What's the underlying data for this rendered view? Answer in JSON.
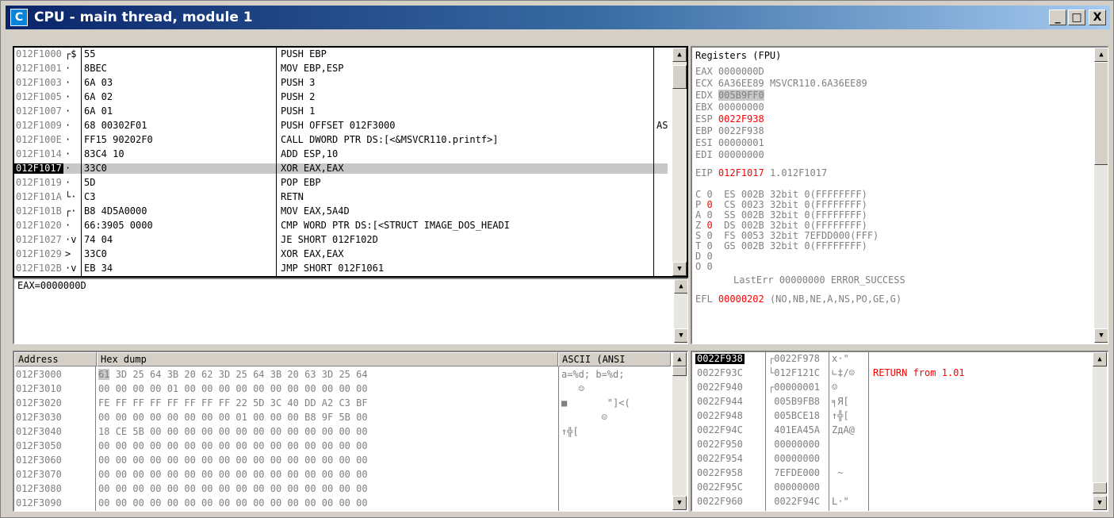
{
  "window": {
    "title": "CPU - main thread, module 1",
    "icon_letter": "C",
    "buttons": {
      "minimize": "_",
      "maximize": "□",
      "close": "X"
    }
  },
  "disasm": {
    "rows": [
      {
        "addr": "012F1000",
        "mark": "┌$",
        "hex": "55",
        "asm": "PUSH EBP",
        "cmt": ""
      },
      {
        "addr": "012F1001",
        "mark": "·",
        "hex": "8BEC",
        "asm": "MOV EBP,ESP",
        "cmt": ""
      },
      {
        "addr": "012F1003",
        "mark": "·",
        "hex": "6A 03",
        "asm": "PUSH 3",
        "cmt": ""
      },
      {
        "addr": "012F1005",
        "mark": "·",
        "hex": "6A 02",
        "asm": "PUSH 2",
        "cmt": ""
      },
      {
        "addr": "012F1007",
        "mark": "·",
        "hex": "6A 01",
        "asm": "PUSH 1",
        "cmt": ""
      },
      {
        "addr": "012F1009",
        "mark": "·",
        "hex": "68 00302F01",
        "asm": "PUSH OFFSET 012F3000",
        "cmt": "ASC"
      },
      {
        "addr": "012F100E",
        "mark": "·",
        "hex": "FF15 90202F0",
        "asm": "CALL DWORD PTR DS:[<&MSVCR110.printf>]",
        "cmt": ""
      },
      {
        "addr": "012F1014",
        "mark": "·",
        "hex": "83C4 10",
        "asm": "ADD ESP,10",
        "cmt": ""
      },
      {
        "addr": "012F1017",
        "mark": "·",
        "hex": "33C0",
        "asm": "XOR EAX,EAX",
        "cmt": ""
      },
      {
        "addr": "012F1019",
        "mark": "·",
        "hex": "5D",
        "asm": "POP EBP",
        "cmt": ""
      },
      {
        "addr": "012F101A",
        "mark": "└·",
        "hex": "C3",
        "asm": "RETN",
        "cmt": ""
      },
      {
        "addr": "012F101B",
        "mark": "┌·",
        "hex": "B8 4D5A0000",
        "asm": "MOV EAX,5A4D",
        "cmt": ""
      },
      {
        "addr": "012F1020",
        "mark": "·",
        "hex": "66:3905 0000",
        "asm": "CMP WORD PTR DS:[<STRUCT IMAGE_DOS_HEADI",
        "cmt": ""
      },
      {
        "addr": "012F1027",
        "mark": "·v",
        "hex": "74 04",
        "asm": "JE SHORT 012F102D",
        "cmt": ""
      },
      {
        "addr": "012F1029",
        "mark": ">",
        "hex": "33C0",
        "asm": "XOR EAX,EAX",
        "cmt": ""
      },
      {
        "addr": "012F102B",
        "mark": "·v",
        "hex": "EB 34",
        "asm": "JMP SHORT 012F1061",
        "cmt": ""
      }
    ]
  },
  "info": {
    "text": "EAX=0000000D"
  },
  "registers": {
    "header": "Registers (FPU)",
    "gp": [
      {
        "name": "EAX",
        "value": "0000000D",
        "note": ""
      },
      {
        "name": "ECX",
        "value": "6A36EE89",
        "note": "MSVCR110.6A36EE89"
      },
      {
        "name": "EDX",
        "value": "005B9FF0",
        "note": ""
      },
      {
        "name": "EBX",
        "value": "00000000",
        "note": ""
      },
      {
        "name": "ESP",
        "value": "0022F938",
        "note": ""
      },
      {
        "name": "EBP",
        "value": "0022F938",
        "note": ""
      },
      {
        "name": "ESI",
        "value": "00000001",
        "note": ""
      },
      {
        "name": "EDI",
        "value": "00000000",
        "note": ""
      }
    ],
    "eip": {
      "name": "EIP",
      "value": "012F1017",
      "note": "1.012F1017"
    },
    "flags": [
      {
        "f": "C",
        "v": "0",
        "seg": "ES",
        "sv": "002B",
        "bits": "32bit",
        "rng": "0(FFFFFFFF)"
      },
      {
        "f": "P",
        "v": "0",
        "seg": "CS",
        "sv": "0023",
        "bits": "32bit",
        "rng": "0(FFFFFFFF)"
      },
      {
        "f": "A",
        "v": "0",
        "seg": "SS",
        "sv": "002B",
        "bits": "32bit",
        "rng": "0(FFFFFFFF)"
      },
      {
        "f": "Z",
        "v": "0",
        "seg": "DS",
        "sv": "002B",
        "bits": "32bit",
        "rng": "0(FFFFFFFF)"
      },
      {
        "f": "S",
        "v": "0",
        "seg": "FS",
        "sv": "0053",
        "bits": "32bit",
        "rng": "7EFDD000(FFF)"
      },
      {
        "f": "T",
        "v": "0",
        "seg": "GS",
        "sv": "002B",
        "bits": "32bit",
        "rng": "0(FFFFFFFF)"
      },
      {
        "f": "D",
        "v": "0",
        "seg": "",
        "sv": "",
        "bits": "",
        "rng": ""
      },
      {
        "f": "O",
        "v": "0",
        "seg": "",
        "sv": "",
        "bits": "",
        "rng": ""
      }
    ],
    "lasterr": {
      "name": "LastErr",
      "value": "00000000 ERROR_SUCCESS"
    },
    "efl": {
      "name": "EFL",
      "value": "00000202",
      "note": "(NO,NB,NE,A,NS,PO,GE,G)"
    }
  },
  "dump": {
    "headers": {
      "address": "Address",
      "hex": "Hex dump",
      "ascii": "ASCII (ANSI"
    },
    "rows": [
      {
        "addr": "012F3000",
        "first": "61",
        "rest": "3D 25 64 3B 20 62 3D 25 64 3B 20 63 3D 25 64",
        "ascii": "a=%d; b=%d;"
      },
      {
        "addr": "012F3010",
        "first": "00",
        "rest": "00 00 00 01 00 00 00 00 00 00 00 00 00 00 00",
        "ascii": "   ☺"
      },
      {
        "addr": "012F3020",
        "first": "FE",
        "rest": "FF FF FF FF FF FF FF 22 5D 3C 40 DD A2 C3 BF",
        "ascii": "■       \"]<("
      },
      {
        "addr": "012F3030",
        "first": "00",
        "rest": "00 00 00 00 00 00 00 01 00 00 00 B8 9F 5B 00",
        "ascii": "       ☺"
      },
      {
        "addr": "012F3040",
        "first": "18",
        "rest": "CE 5B 00 00 00 00 00 00 00 00 00 00 00 00 00",
        "ascii": "↑╬["
      },
      {
        "addr": "012F3050",
        "first": "00",
        "rest": "00 00 00 00 00 00 00 00 00 00 00 00 00 00 00",
        "ascii": ""
      },
      {
        "addr": "012F3060",
        "first": "00",
        "rest": "00 00 00 00 00 00 00 00 00 00 00 00 00 00 00",
        "ascii": ""
      },
      {
        "addr": "012F3070",
        "first": "00",
        "rest": "00 00 00 00 00 00 00 00 00 00 00 00 00 00 00",
        "ascii": ""
      },
      {
        "addr": "012F3080",
        "first": "00",
        "rest": "00 00 00 00 00 00 00 00 00 00 00 00 00 00 00",
        "ascii": ""
      },
      {
        "addr": "012F3090",
        "first": "00",
        "rest": "00 00 00 00 00 00 00 00 00 00 00 00 00 00 00",
        "ascii": ""
      }
    ]
  },
  "stack": {
    "rows": [
      {
        "addr": "0022F938",
        "val": "┌0022F978",
        "asc": "x·\"",
        "cmt": ""
      },
      {
        "addr": "0022F93C",
        "val": "└012F121C",
        "asc": "∟‡/☺",
        "cmt": "RETURN from 1.01"
      },
      {
        "addr": "0022F940",
        "val": "┌00000001",
        "asc": "☺",
        "cmt": ""
      },
      {
        "addr": "0022F944",
        "val": " 005B9FB8",
        "asc": "╕Я[",
        "cmt": ""
      },
      {
        "addr": "0022F948",
        "val": " 005BCE18",
        "asc": "↑╬[",
        "cmt": ""
      },
      {
        "addr": "0022F94C",
        "val": " 401EA45A",
        "asc": "ZдA@",
        "cmt": ""
      },
      {
        "addr": "0022F950",
        "val": " 00000000",
        "asc": "",
        "cmt": ""
      },
      {
        "addr": "0022F954",
        "val": " 00000000",
        "asc": "",
        "cmt": ""
      },
      {
        "addr": "0022F958",
        "val": " 7EFDE000",
        "asc": " ~",
        "cmt": ""
      },
      {
        "addr": "0022F95C",
        "val": " 00000000",
        "asc": "",
        "cmt": ""
      },
      {
        "addr": "0022F960",
        "val": " 0022F94C",
        "asc": "L·\"",
        "cmt": ""
      }
    ]
  },
  "colors": {
    "title_start": "#0a246a",
    "title_end": "#a6caf0",
    "red": "#ff0000",
    "selection": "#c8c8c8"
  }
}
